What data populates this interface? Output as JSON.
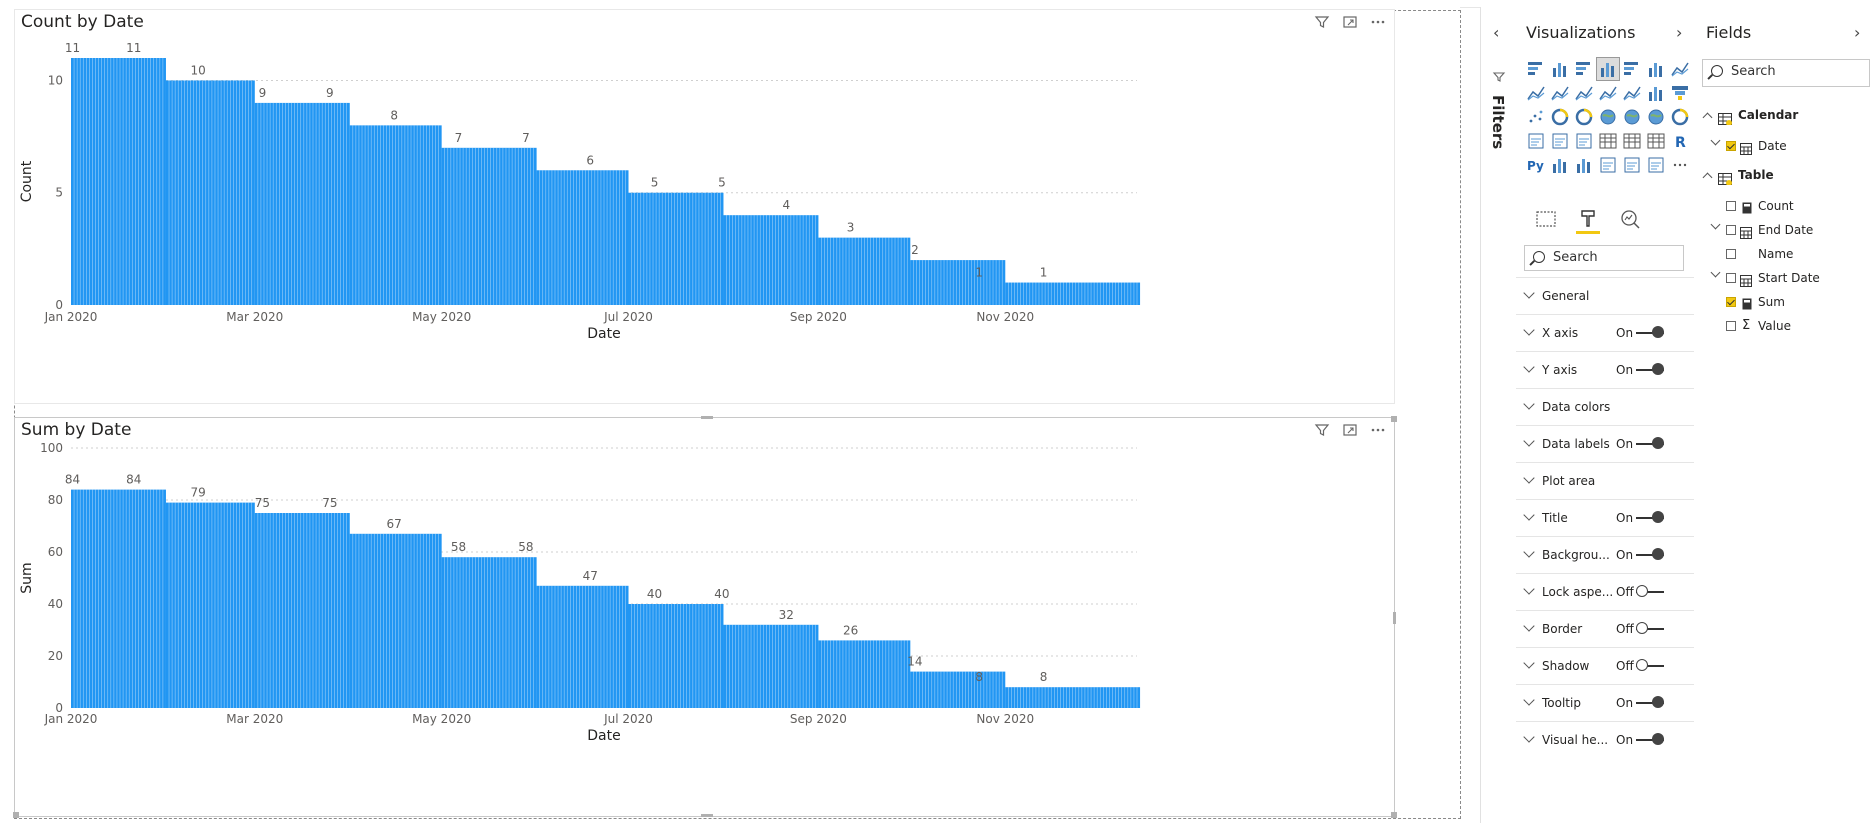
{
  "colors": {
    "bar": "#2196f3",
    "accent": "#f2c811",
    "text": "#252423",
    "muted": "#605e5c"
  },
  "panes": {
    "filters_label": "Filters",
    "visualizations_title": "Visualizations",
    "fields_title": "Fields"
  },
  "viz_icons": [
    "stacked-bar-icon",
    "stacked-column-icon",
    "clustered-bar-icon",
    "clustered-column-icon",
    "100-bar-icon",
    "100-column-icon",
    "line-chart-icon",
    "area-chart-icon",
    "stacked-area-icon",
    "line-column-icon",
    "line-clustered-column-icon",
    "ribbon-chart-icon",
    "waterfall-icon",
    "funnel-icon",
    "scatter-icon",
    "pie-icon",
    "donut-icon",
    "treemap-icon",
    "map-icon",
    "filled-map-icon",
    "gauge-icon",
    "card-icon",
    "multirow-card-icon",
    "kpi-icon",
    "slicer-icon",
    "table-icon",
    "matrix-icon",
    "r-visual-icon",
    "python-visual-icon",
    "key-influencers-icon",
    "decomposition-tree-icon",
    "qna-icon",
    "smart-narrative-icon",
    "paginated-report-icon",
    "more-visuals-icon"
  ],
  "format_search_placeholder": "Search",
  "fields_search_placeholder": "Search",
  "format_rows": [
    {
      "name": "General",
      "state": "",
      "toggle": ""
    },
    {
      "name": "X axis",
      "state": "On",
      "toggle": "on"
    },
    {
      "name": "Y axis",
      "state": "On",
      "toggle": "on"
    },
    {
      "name": "Data colors",
      "state": "",
      "toggle": ""
    },
    {
      "name": "Data labels",
      "state": "On",
      "toggle": "on"
    },
    {
      "name": "Plot area",
      "state": "",
      "toggle": ""
    },
    {
      "name": "Title",
      "state": "On",
      "toggle": "on"
    },
    {
      "name": "Backgrou...",
      "state": "On",
      "toggle": "on"
    },
    {
      "name": "Lock aspe...",
      "state": "Off",
      "toggle": "off"
    },
    {
      "name": "Border",
      "state": "Off",
      "toggle": "off"
    },
    {
      "name": "Shadow",
      "state": "Off",
      "toggle": "off"
    },
    {
      "name": "Tooltip",
      "state": "On",
      "toggle": "on"
    },
    {
      "name": "Visual he...",
      "state": "On",
      "toggle": "on"
    }
  ],
  "fields": {
    "calendar_label": "Calendar",
    "calendar_date": "Date",
    "table_label": "Table",
    "table_count": "Count",
    "table_end_date": "End Date",
    "table_name": "Name",
    "table_start_date": "Start Date",
    "table_sum": "Sum",
    "table_value": "Value"
  },
  "chart_data": [
    {
      "type": "bar",
      "title": "Count by Date",
      "xlabel": "Date",
      "ylabel": "Count",
      "ylim": [
        0,
        11
      ],
      "yticks": [
        0,
        5,
        10
      ],
      "grid": true,
      "xticks": [
        "Jan 2020",
        "Mar 2020",
        "May 2020",
        "Jul 2020",
        "Sep 2020",
        "Nov 2020"
      ],
      "segments": [
        {
          "start": "2020-01-01",
          "end": "2020-01-31",
          "value": 11
        },
        {
          "start": "2020-02-01",
          "end": "2020-02-29",
          "value": 10
        },
        {
          "start": "2020-03-01",
          "end": "2020-03-31",
          "value": 9
        },
        {
          "start": "2020-04-01",
          "end": "2020-04-30",
          "value": 8
        },
        {
          "start": "2020-05-01",
          "end": "2020-05-31",
          "value": 7
        },
        {
          "start": "2020-06-01",
          "end": "2020-06-30",
          "value": 6
        },
        {
          "start": "2020-07-01",
          "end": "2020-07-31",
          "value": 5
        },
        {
          "start": "2020-08-01",
          "end": "2020-08-31",
          "value": 4
        },
        {
          "start": "2020-09-01",
          "end": "2020-09-30",
          "value": 3
        },
        {
          "start": "2020-10-01",
          "end": "2020-10-31",
          "value": 2
        },
        {
          "start": "2020-11-01",
          "end": "2020-12-14",
          "value": 1
        }
      ],
      "data_labels": [
        {
          "date": "2020-01-01",
          "value": 11
        },
        {
          "date": "2020-01-21",
          "value": 11
        },
        {
          "date": "2020-02-11",
          "value": 10
        },
        {
          "date": "2020-03-03",
          "value": 9
        },
        {
          "date": "2020-03-25",
          "value": 9
        },
        {
          "date": "2020-04-15",
          "value": 8
        },
        {
          "date": "2020-05-06",
          "value": 7
        },
        {
          "date": "2020-05-28",
          "value": 7
        },
        {
          "date": "2020-06-18",
          "value": 6
        },
        {
          "date": "2020-07-09",
          "value": 5
        },
        {
          "date": "2020-07-31",
          "value": 5
        },
        {
          "date": "2020-08-21",
          "value": 4
        },
        {
          "date": "2020-09-11",
          "value": 3
        },
        {
          "date": "2020-10-02",
          "value": 2
        },
        {
          "date": "2020-10-23",
          "value": 1
        },
        {
          "date": "2020-11-13",
          "value": 1
        }
      ]
    },
    {
      "type": "bar",
      "title": "Sum by Date",
      "xlabel": "Date",
      "ylabel": "Sum",
      "ylim": [
        0,
        100
      ],
      "yticks": [
        0,
        20,
        40,
        60,
        80,
        100
      ],
      "grid": true,
      "xticks": [
        "Jan 2020",
        "Mar 2020",
        "May 2020",
        "Jul 2020",
        "Sep 2020",
        "Nov 2020"
      ],
      "segments": [
        {
          "start": "2020-01-01",
          "end": "2020-01-31",
          "value": 84
        },
        {
          "start": "2020-02-01",
          "end": "2020-02-29",
          "value": 79
        },
        {
          "start": "2020-03-01",
          "end": "2020-03-31",
          "value": 75
        },
        {
          "start": "2020-04-01",
          "end": "2020-04-30",
          "value": 67
        },
        {
          "start": "2020-05-01",
          "end": "2020-05-31",
          "value": 58
        },
        {
          "start": "2020-06-01",
          "end": "2020-06-30",
          "value": 47
        },
        {
          "start": "2020-07-01",
          "end": "2020-07-31",
          "value": 40
        },
        {
          "start": "2020-08-01",
          "end": "2020-08-31",
          "value": 32
        },
        {
          "start": "2020-09-01",
          "end": "2020-09-30",
          "value": 26
        },
        {
          "start": "2020-10-01",
          "end": "2020-10-31",
          "value": 14
        },
        {
          "start": "2020-11-01",
          "end": "2020-12-14",
          "value": 8
        }
      ],
      "data_labels": [
        {
          "date": "2020-01-01",
          "value": 84
        },
        {
          "date": "2020-01-21",
          "value": 84
        },
        {
          "date": "2020-02-11",
          "value": 79
        },
        {
          "date": "2020-03-03",
          "value": 75
        },
        {
          "date": "2020-03-25",
          "value": 75
        },
        {
          "date": "2020-04-15",
          "value": 67
        },
        {
          "date": "2020-05-06",
          "value": 58
        },
        {
          "date": "2020-05-28",
          "value": 58
        },
        {
          "date": "2020-06-18",
          "value": 47
        },
        {
          "date": "2020-07-09",
          "value": 40
        },
        {
          "date": "2020-07-31",
          "value": 40
        },
        {
          "date": "2020-08-21",
          "value": 32
        },
        {
          "date": "2020-09-11",
          "value": 26
        },
        {
          "date": "2020-10-02",
          "value": 14
        },
        {
          "date": "2020-10-23",
          "value": 8
        },
        {
          "date": "2020-11-13",
          "value": 8
        }
      ]
    }
  ]
}
